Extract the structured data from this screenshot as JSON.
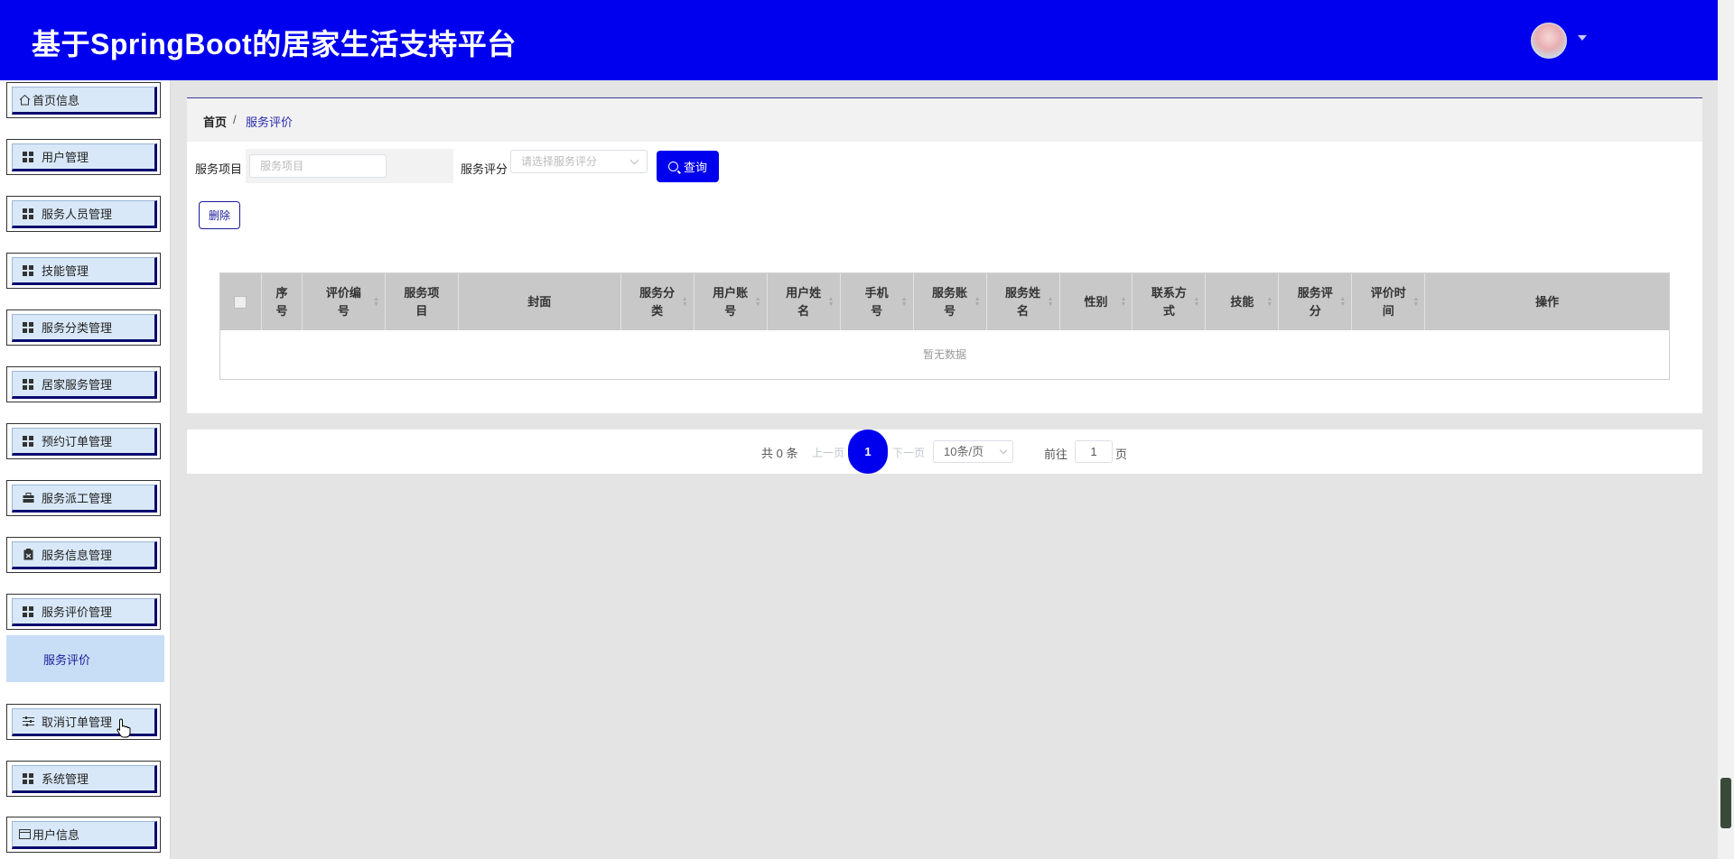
{
  "app": {
    "title": "基于SpringBoot的居家生活支持平台"
  },
  "sidebar": {
    "items": [
      {
        "label": "首页信息",
        "icon": "home-icon"
      },
      {
        "label": "用户管理",
        "icon": "grid-icon"
      },
      {
        "label": "服务人员管理",
        "icon": "grid-icon"
      },
      {
        "label": "技能管理",
        "icon": "grid-icon"
      },
      {
        "label": "服务分类管理",
        "icon": "grid-icon"
      },
      {
        "label": "居家服务管理",
        "icon": "grid-icon"
      },
      {
        "label": "预约订单管理",
        "icon": "grid-icon"
      },
      {
        "label": "服务派工管理",
        "icon": "briefcase-icon"
      },
      {
        "label": "服务信息管理",
        "icon": "clipboard-icon"
      },
      {
        "label": "服务评价管理",
        "icon": "grid-icon"
      },
      {
        "label": "取消订单管理",
        "icon": "sliders-icon"
      },
      {
        "label": "系统管理",
        "icon": "grid-icon"
      },
      {
        "label": "用户信息",
        "icon": "card-icon"
      }
    ],
    "sub_item": {
      "label": "服务评价"
    }
  },
  "breadcrumb": {
    "home": "首页",
    "separator": "/",
    "current": "服务评价"
  },
  "filters": {
    "item_label": "服务项目",
    "item_placeholder": "服务项目",
    "rating_label": "服务评分",
    "rating_placeholder": "请选择服务评分",
    "query_label": "查询"
  },
  "actions": {
    "delete_label": "删除"
  },
  "table": {
    "columns": [
      "序号",
      "评价编号",
      "服务项目",
      "封面",
      "服务分类",
      "用户账号",
      "用户姓名",
      "手机号",
      "服务账号",
      "服务姓名",
      "性别",
      "联系方式",
      "技能",
      "服务评分",
      "评价时间",
      "操作"
    ],
    "rows": [],
    "empty_text": "暂无数据"
  },
  "pagination": {
    "total": "共 0 条",
    "prev": "上一页",
    "current_page": "1",
    "next": "下一页",
    "page_size": "10条/页",
    "goto": "前往",
    "goto_value": "1",
    "page_unit": "页"
  },
  "colors": {
    "primary": "#0000ee",
    "menu_bg": "#d8e8f8",
    "submenu_bg": "#c8def6",
    "table_header": "#c8c8c8"
  }
}
